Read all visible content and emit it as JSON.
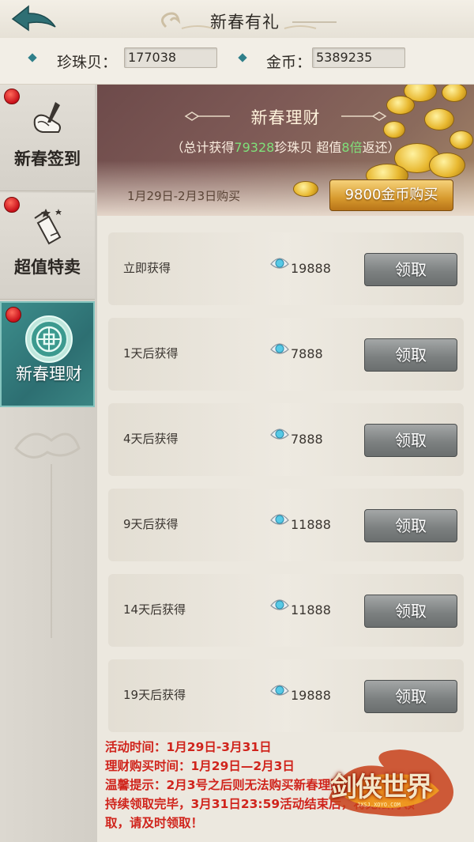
{
  "header": {
    "title": "新春有礼"
  },
  "currency": {
    "pearl_label": "珍珠贝：",
    "pearl_value": "177038",
    "gold_label": "金币：",
    "gold_value": "5389235"
  },
  "sidebar": {
    "tabs": [
      {
        "label": "新春签到",
        "icon": "signin-scroll-icon",
        "active": false
      },
      {
        "label": "超值特卖",
        "icon": "sale-tag-icon",
        "active": false
      },
      {
        "label": "新春理财",
        "icon": "coin-medallion-icon",
        "active": true
      }
    ]
  },
  "banner": {
    "title": "新春理财",
    "sub_prefix": "（总计获得",
    "sub_total": "79328",
    "sub_mid": "珍珠贝  超值",
    "sub_mult": "8倍",
    "sub_suffix": "返还）",
    "dates": "1月29日-2月3日购买",
    "buy_label": "9800金币购买"
  },
  "rewards": [
    {
      "label": "立即获得",
      "amount": "19888",
      "button": "领取"
    },
    {
      "label": "1天后获得",
      "amount": "7888",
      "button": "领取"
    },
    {
      "label": "4天后获得",
      "amount": "7888",
      "button": "领取"
    },
    {
      "label": "9天后获得",
      "amount": "11888",
      "button": "领取"
    },
    {
      "label": "14天后获得",
      "amount": "11888",
      "button": "领取"
    },
    {
      "label": "19天后获得",
      "amount": "19888",
      "button": "领取"
    }
  ],
  "notes": {
    "line1": "活动时间：1月29日-3月31日",
    "line2": "理财购买时间：1月29日—2月3日",
    "line3": "温馨提示：2月3号之后则无法购买新春理财，已购买的可",
    "line4": "持续领取完毕，3月31日23:59活动结束后，将无法再领",
    "line5": "取，请及时领取！"
  },
  "logo": {
    "text": "剑侠世界",
    "url": "JXSJ.XOYO.COM"
  },
  "colors": {
    "accent_teal": "#2f7f8a",
    "highlight_green": "#7fe07a",
    "notice_red": "#d0241c",
    "gold": "#d79a2e"
  }
}
